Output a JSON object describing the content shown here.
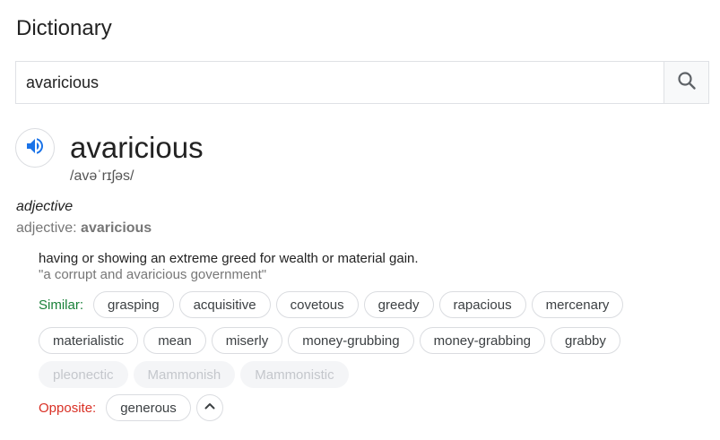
{
  "header": {
    "title": "Dictionary"
  },
  "search": {
    "value": "avaricious"
  },
  "entry": {
    "word": "avaricious",
    "phonetic": "/avəˈrɪʃəs/",
    "pos_italic": "adjective",
    "pos_prefix": "adjective: ",
    "pos_word": "avaricious",
    "definition": "having or showing an extreme greed for wealth or material gain.",
    "example": "\"a corrupt and avaricious government\""
  },
  "similar": {
    "label": "Similar:",
    "row1": [
      "grasping",
      "acquisitive",
      "covetous",
      "greedy",
      "rapacious",
      "mercenary"
    ],
    "row2": [
      "materialistic",
      "mean",
      "miserly",
      "money-grubbing",
      "money-grabbing",
      "grabby"
    ],
    "row3": [
      "pleonectic",
      "Mammonish",
      "Mammonistic"
    ]
  },
  "opposite": {
    "label": "Opposite:",
    "items": [
      "generous"
    ]
  },
  "colors": {
    "accent_blue": "#1a73e8",
    "similar_green": "#188038",
    "opposite_red": "#d93025"
  },
  "icons": {
    "search": "search-icon",
    "speaker": "speaker-icon",
    "collapse": "chevron-up-icon"
  }
}
